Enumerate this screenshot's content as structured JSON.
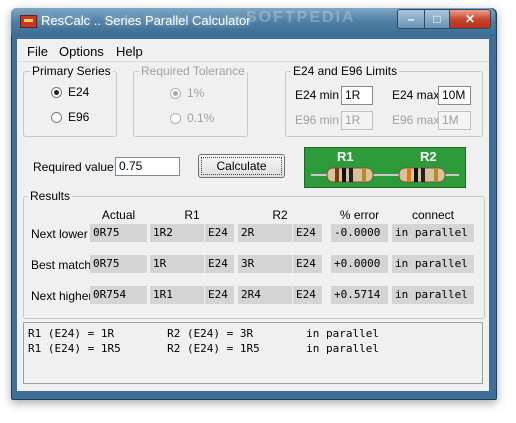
{
  "window": {
    "title": "ResCalc .. Series Parallel Calculator",
    "watermark": "SOFTPEDIA",
    "controls": {
      "minimize": "–",
      "maximize": "□",
      "close": "✕"
    }
  },
  "menu": {
    "items": [
      "File",
      "Options",
      "Help"
    ]
  },
  "primary_series": {
    "title": "Primary Series",
    "options": [
      {
        "label": "E24",
        "selected": true
      },
      {
        "label": "E96",
        "selected": false
      }
    ]
  },
  "required_tolerance": {
    "title": "Required Tolerance",
    "options": [
      {
        "label": "1%",
        "selected": true
      },
      {
        "label": "0.1%",
        "selected": false
      }
    ]
  },
  "limits": {
    "title": "E24 and E96 Limits",
    "e24_min_label": "E24 min",
    "e24_min_value": "1R",
    "e24_max_label": "E24 max",
    "e24_max_value": "10M",
    "e96_min_label": "E96 min",
    "e96_min_value": "1R",
    "e96_max_label": "E96 max",
    "e96_max_value": "1M"
  },
  "required": {
    "label": "Required value:",
    "value": "0.75"
  },
  "calculate_label": "Calculate",
  "resistors": {
    "r1_label": "R1",
    "r2_label": "R2"
  },
  "results": {
    "title": "Results",
    "headers": {
      "actual": "Actual",
      "r1": "R1",
      "r2": "R2",
      "error": "% error",
      "connect": "connect"
    },
    "rows": [
      {
        "label": "Next lower",
        "actual": "0R75",
        "r1": "1R2",
        "r1_series": "E24",
        "r2": "2R",
        "r2_series": "E24",
        "error": "-0.0000",
        "connect": "in parallel"
      },
      {
        "label": "Best match",
        "actual": "0R75",
        "r1": "1R",
        "r1_series": "E24",
        "r2": "3R",
        "r2_series": "E24",
        "error": "+0.0000",
        "connect": "in parallel"
      },
      {
        "label": "Next higher",
        "actual": "0R754",
        "r1": "1R1",
        "r1_series": "E24",
        "r2": "2R4",
        "r2_series": "E24",
        "error": "+0.5714",
        "connect": "in parallel"
      }
    ]
  },
  "output_lines": [
    "R1 (E24) = 1R        R2 (E24) = 3R        in parallel",
    "R1 (E24) = 1R5       R2 (E24) = 1R5       in parallel"
  ],
  "colors": {
    "titlebar": "#4d7ea4",
    "resistor_panel": "#2e9b3a",
    "close": "#c8412a"
  }
}
